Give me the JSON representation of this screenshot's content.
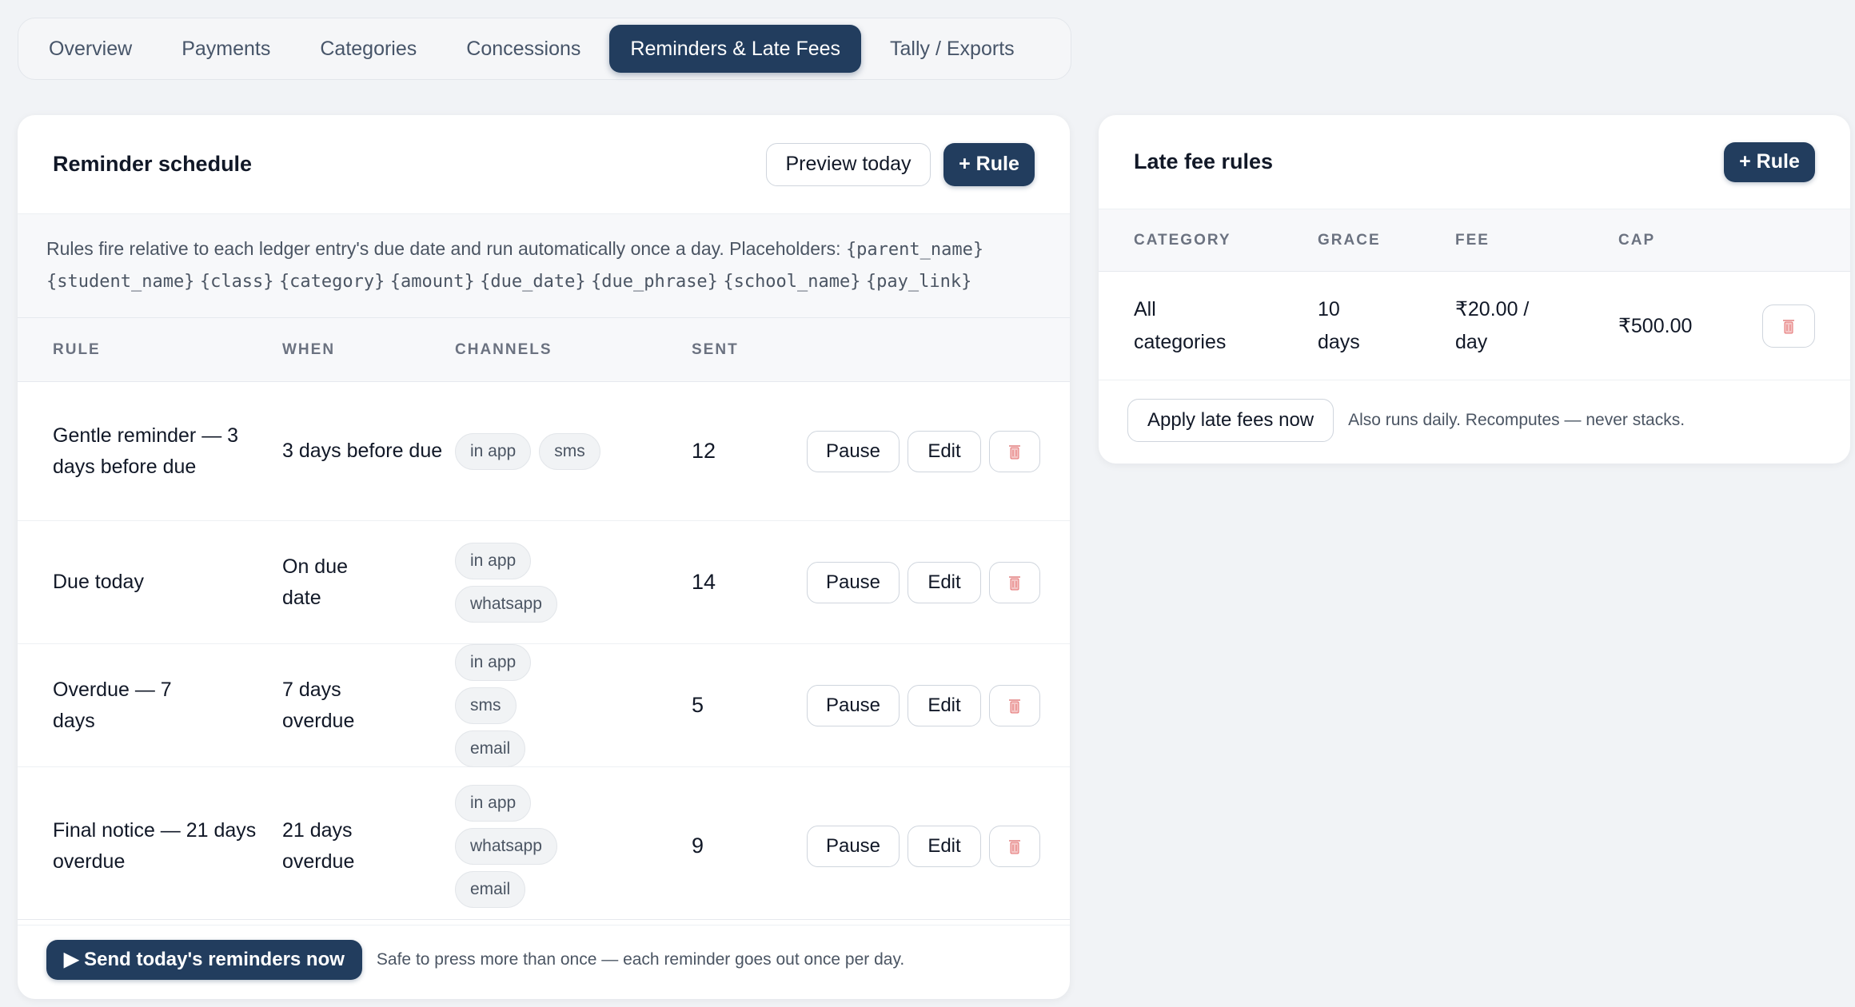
{
  "tabs": [
    {
      "label": "Overview"
    },
    {
      "label": "Payments"
    },
    {
      "label": "Categories"
    },
    {
      "label": "Concessions"
    },
    {
      "label": "Reminders & Late Fees",
      "active": true
    },
    {
      "label": "Tally / Exports"
    }
  ],
  "reminders": {
    "title": "Reminder schedule",
    "preview_label": "Preview today",
    "add_rule_label": "+ Rule",
    "info_text": "Rules fire relative to each ledger entry's due date and run automatically once a day. Placeholders:",
    "placeholders": [
      "{parent_name}",
      "{student_name}",
      "{class}",
      "{category}",
      "{amount}",
      "{due_date}",
      "{due_phrase}",
      "{school_name}",
      "{pay_link}"
    ],
    "columns": {
      "rule": "RULE",
      "when": "WHEN",
      "channels": "CHANNELS",
      "sent": "SENT"
    },
    "rows": [
      {
        "rule": "Gentle reminder — 3 days before due",
        "when": "3 days before due",
        "channels": [
          "in app",
          "sms"
        ],
        "sent": "12"
      },
      {
        "rule": "Due today",
        "when": "On due date",
        "channels": [
          "in app",
          "whatsapp"
        ],
        "sent": "14"
      },
      {
        "rule": "Overdue — 7 days",
        "when": "7 days overdue",
        "channels": [
          "in app",
          "sms",
          "email"
        ],
        "sent": "5"
      },
      {
        "rule": "Final notice — 21 days overdue",
        "when": "21 days overdue",
        "channels": [
          "in app",
          "whatsapp",
          "email"
        ],
        "sent": "9"
      }
    ],
    "pause_label": "Pause",
    "edit_label": "Edit",
    "send_now_label": "▶ Send today's reminders now",
    "send_note": "Safe to press more than once — each reminder goes out once per day."
  },
  "late_fees": {
    "title": "Late fee rules",
    "add_rule_label": "+ Rule",
    "columns": {
      "category": "CATEGORY",
      "grace": "GRACE",
      "fee": "FEE",
      "cap": "CAP"
    },
    "rows": [
      {
        "category": "All categories",
        "grace": "10 days",
        "fee": "₹20.00 / day",
        "cap": "₹500.00"
      }
    ],
    "apply_label": "Apply late fees now",
    "apply_note": "Also runs daily. Recomputes — never stacks."
  },
  "colors": {
    "primary": "#223d5e",
    "trash": "#e57373"
  },
  "icons": {
    "trash": "trash-icon",
    "play": "play-icon"
  }
}
